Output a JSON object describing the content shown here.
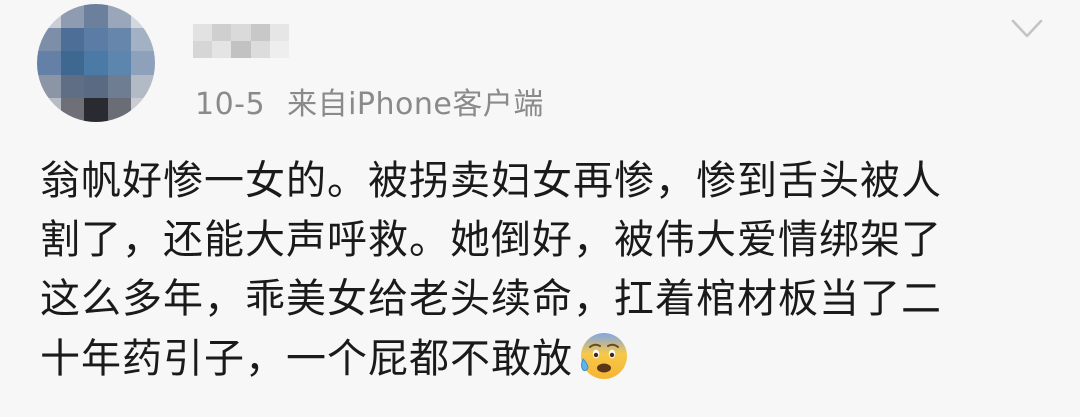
{
  "post": {
    "date": "10-5",
    "source": "来自iPhone客户端",
    "lines": [
      "翁帆好惨一女的。被拐卖妇女再惨，惨到舌头被人",
      "割了，还能大声呼救。她倒好，被伟大爱情绑架了",
      "这么多年，乖美女给老头续命，扛着棺材板当了二",
      "十年药引子，一个屁都不敢放"
    ],
    "emoji": "anxious-face-with-sweat-icon"
  },
  "icons": {
    "menu": "chevron-down-icon"
  },
  "colors": {
    "background": "#f7f7f7",
    "meta_text": "#8a8a8a",
    "body_text": "#1a1a1a",
    "chevron": "#c4c4c4"
  }
}
